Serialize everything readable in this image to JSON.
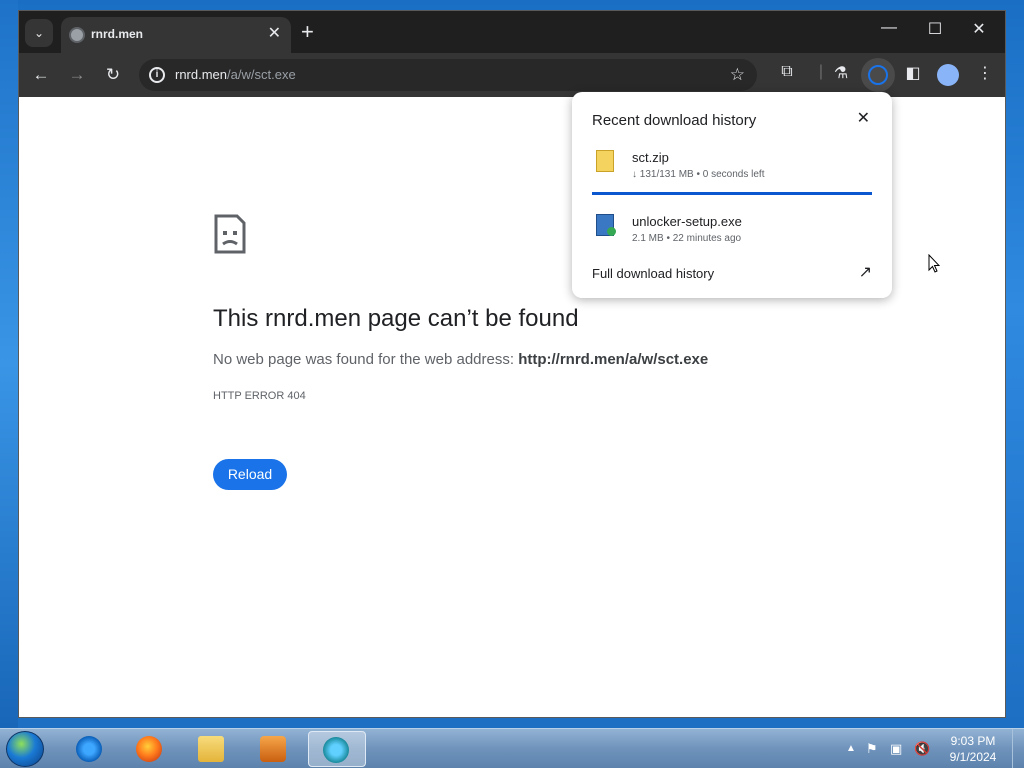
{
  "browser": {
    "tab": {
      "title": "rnrd.men",
      "favicon": "globe-icon"
    },
    "new_tab_icon": "+",
    "window_controls": {
      "minimize": "—",
      "maximize": "☐",
      "close": "✕"
    },
    "address": {
      "host": "rnrd.men",
      "path": "/a/w/sct.exe"
    }
  },
  "page": {
    "title": "This rnrd.men page can’t be found",
    "description_prefix": "No web page was found for the web address: ",
    "description_url": "http://rnrd.men/a/w/sct.exe",
    "error_code": "HTTP ERROR 404",
    "reload_label": "Reload"
  },
  "downloads": {
    "heading": "Recent download history",
    "items": [
      {
        "name": "sct.zip",
        "status": "↓ 131/131 MB • 0 seconds left",
        "progress": 1.0,
        "icon": "zip-file-icon"
      },
      {
        "name": "unlocker-setup.exe",
        "status": "2.1 MB • 22 minutes ago",
        "icon": "installer-file-icon"
      }
    ],
    "footer_label": "Full download history"
  },
  "taskbar": {
    "apps": [
      "internet-explorer",
      "firefox",
      "file-explorer",
      "media-player",
      "chrome-like-browser"
    ],
    "clock_time": "9:03 PM",
    "clock_date": "9/1/2024"
  },
  "colors": {
    "accent": "#1a73e8",
    "progress": "#0b57d0",
    "toolbar": "#353535",
    "tabstrip": "#1f1f1f"
  }
}
